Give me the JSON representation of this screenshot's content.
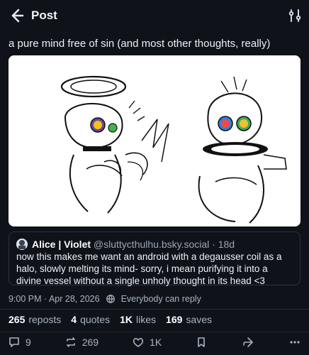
{
  "header": {
    "title": "Post"
  },
  "post": {
    "text": "a pure mind free of sin (and most other thoughts, really)",
    "timestamp": "9:00 PM · Apr 28, 2026",
    "visibility": "Everybody can reply"
  },
  "quote": {
    "name": "Alice | Violet",
    "handle": "@sluttycthulhu.bsky.social",
    "time": "· 18d",
    "text": "now this makes me want an android with a degausser coil as a halo, slowly melting its mind- sorry, i mean purifying it into a divine vessel without a single unholy thought in its head <3"
  },
  "stats": {
    "reposts_count": "265",
    "reposts_label": "reposts",
    "quotes_count": "4",
    "quotes_label": "quotes",
    "likes_count": "1K",
    "likes_label": "likes",
    "saves_count": "169",
    "saves_label": "saves"
  },
  "actions": {
    "replies": "9",
    "reposts": "269",
    "likes": "1K"
  },
  "theme": {
    "background": "#0f1219",
    "text": "#e6ebf2",
    "muted": "#a7b4c6",
    "border": "#2b3342"
  },
  "icons": {
    "back": "arrow-left-icon",
    "filter": "sliders-icon",
    "globe": "globe-icon",
    "reply": "comment-icon",
    "repost": "repost-icon",
    "like": "heart-icon",
    "bookmark": "bookmark-icon",
    "share": "share-icon",
    "more": "more-icon"
  }
}
